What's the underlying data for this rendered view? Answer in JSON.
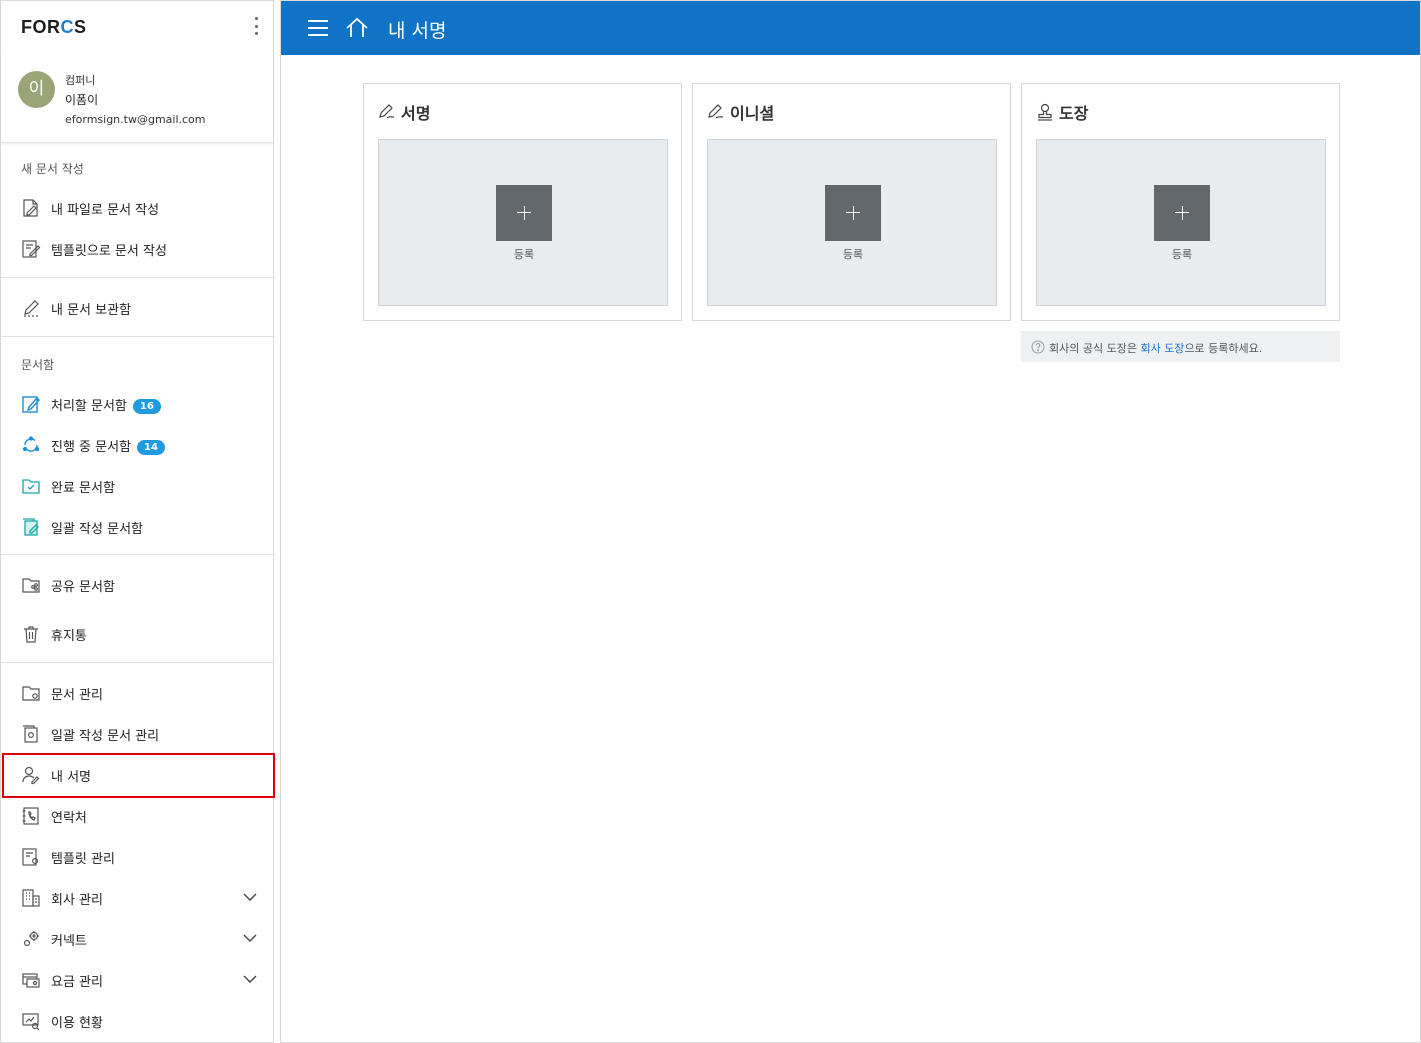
{
  "brand": {
    "logo_left": "FOR",
    "logo_accent": "C",
    "logo_right": "S"
  },
  "user": {
    "avatar_initial": "이",
    "company": "컴퍼니",
    "name": "이폼이",
    "email": "eformsign.tw@gmail.com"
  },
  "sidebar": {
    "section_new": "새 문서 작성",
    "new_from_file": "내 파일로 문서 작성",
    "new_from_template": "템플릿으로 문서 작성",
    "my_storage": "내 문서 보관함",
    "section_box": "문서함",
    "to_process": "처리할 문서함",
    "to_process_count": "16",
    "in_progress": "진행 중 문서함",
    "in_progress_count": "14",
    "completed": "완료 문서함",
    "bulk_box": "일괄 작성 문서함",
    "shared": "공유 문서함",
    "trash": "휴지통",
    "doc_manage": "문서 관리",
    "bulk_manage": "일괄 작성 문서 관리",
    "my_signature": "내 서명",
    "contacts": "연락처",
    "template_manage": "템플릿 관리",
    "company_manage": "회사 관리",
    "connect": "커넥트",
    "billing": "요금 관리",
    "usage": "이용 현황"
  },
  "header": {
    "title": "내 서명"
  },
  "cards": [
    {
      "title": "서명",
      "add_label": "등록"
    },
    {
      "title": "이니셜",
      "add_label": "등록"
    },
    {
      "title": "도장",
      "add_label": "등록"
    }
  ],
  "note": {
    "prefix": "회사의 공식 도장은 ",
    "link": "회사 도장",
    "suffix": "으로 등록하세요."
  },
  "colors": {
    "header_blue": "#1173c5",
    "badge_blue": "#1e9ae0",
    "highlight_red": "#e00000",
    "add_button": "#63686c"
  }
}
